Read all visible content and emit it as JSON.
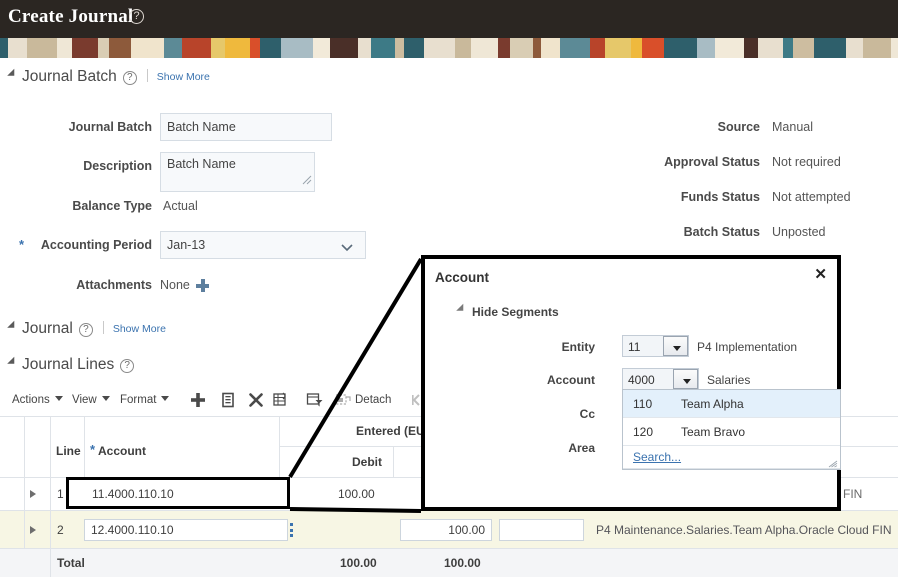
{
  "header": {
    "title": "Create Journal",
    "help_icon": "help-circle-icon"
  },
  "sections": {
    "journal_batch": {
      "label": "Journal Batch",
      "show_more": "Show More"
    },
    "journal": {
      "label": "Journal",
      "show_more": "Show More"
    },
    "journal_lines": {
      "label": "Journal Lines"
    }
  },
  "batch_form": {
    "left": [
      {
        "label": "Journal Batch",
        "type": "input",
        "value": "Batch Name",
        "placeholder": ""
      },
      {
        "label": "Description",
        "type": "textarea",
        "value": "Batch Name",
        "placeholder": ""
      },
      {
        "label": "Balance Type",
        "type": "text",
        "value": "Actual"
      },
      {
        "label": "Accounting Period",
        "type": "select",
        "value": "Jan-13",
        "required": true
      },
      {
        "label": "Attachments",
        "type": "text",
        "value": "None"
      }
    ],
    "right": [
      {
        "label": "Source",
        "value": "Manual"
      },
      {
        "label": "Approval Status",
        "value": "Not required"
      },
      {
        "label": "Funds Status",
        "value": "Not attempted"
      },
      {
        "label": "Batch Status",
        "value": "Unposted"
      }
    ]
  },
  "toolbar": {
    "menus": [
      "Actions",
      "View",
      "Format"
    ],
    "icons": [
      "add-icon",
      "duplicate-icon",
      "delete-icon",
      "line-split-icon",
      "query-filter-icon",
      "detach-icon"
    ],
    "detach_label": "Detach"
  },
  "table": {
    "headers": {
      "line": "Line",
      "account": "Account",
      "account_required": true,
      "entered": "Entered (EU",
      "debit": "Debit"
    },
    "rows": [
      {
        "line": "1",
        "account": "11.4000.110.10",
        "debit": "100.00",
        "credit": "",
        "description": "FIN",
        "editing": false
      },
      {
        "line": "2",
        "account": "12.4000.110.10",
        "debit": "100.00",
        "credit": "",
        "description": "P4 Maintenance.Salaries.Team Alpha.Oracle Cloud FIN",
        "editing": true
      }
    ],
    "total": {
      "label": "Total",
      "debit": "100.00",
      "credit": "100.00"
    }
  },
  "dialog": {
    "title": "Account",
    "close_icon": "close-icon",
    "hide_segments": "Hide Segments",
    "segments": [
      {
        "label": "Entity",
        "value": "11",
        "description": "P4 Implementation"
      },
      {
        "label": "Account",
        "value": "4000",
        "description": "Salaries"
      },
      {
        "label": "Cc",
        "value": "",
        "description": ""
      },
      {
        "label": "Area",
        "value": "",
        "description": ""
      }
    ],
    "dropdown": {
      "options": [
        {
          "code": "110",
          "name": "Team Alpha",
          "selected": true
        },
        {
          "code": "120",
          "name": "Team Bravo",
          "selected": false
        }
      ],
      "search_label": "Search..."
    }
  },
  "colors": {
    "header_bg": "#2b2622",
    "link": "#3b73af",
    "selected_row": "#e3f0fb",
    "edit_row": "#f7f6e4",
    "total_row": "#f4f5f7"
  }
}
